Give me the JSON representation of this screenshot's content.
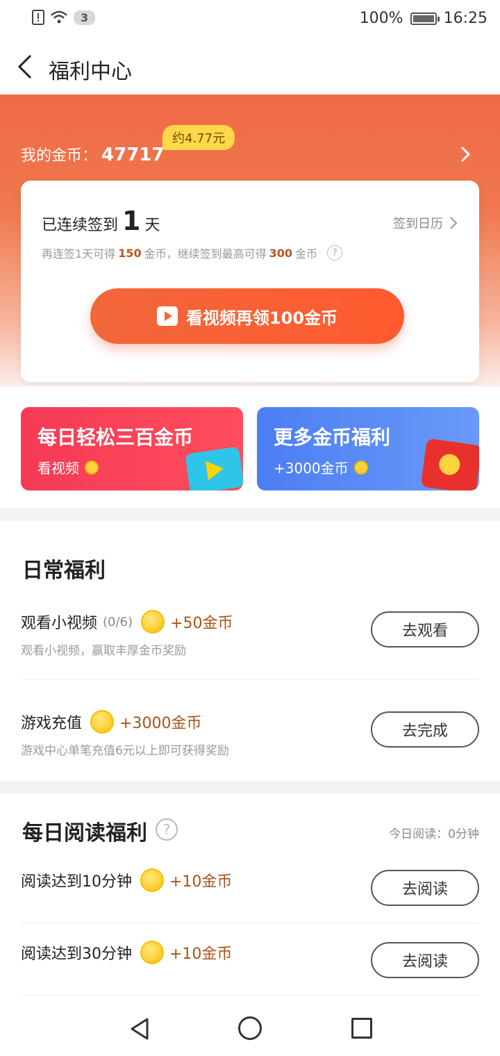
{
  "status_bar": {
    "sim_badge": "3",
    "battery_text": "100%",
    "battery_level": 1.0,
    "time": "16:25"
  },
  "header": {
    "title": "福利中心"
  },
  "coins": {
    "label": "我的金币：",
    "value": "47717",
    "approx": "约4.77元"
  },
  "sign_in": {
    "prefix": "已连续签到",
    "days": "1",
    "suffix": "天",
    "calendar_link": "签到日历",
    "desc_part1": "再连签1天可得",
    "desc_hl1": "150",
    "desc_part2": "金币，继续签到最高可得",
    "desc_hl2": "300",
    "desc_part3": "金币",
    "button": "看视频再领100金币"
  },
  "promos": [
    {
      "title": "每日轻松三百金币",
      "subtitle": "看视频"
    },
    {
      "title": "更多金币福利",
      "subtitle": "+3000金币"
    }
  ],
  "daily": {
    "title": "日常福利",
    "tasks": [
      {
        "name": "观看小视频",
        "progress": "(0/6)",
        "reward": "+50金币",
        "desc": "观看小视频，赢取丰厚金币奖励",
        "button": "去观看"
      },
      {
        "name": "游戏充值",
        "progress": "",
        "reward": "+3000金币",
        "desc": "游戏中心单笔充值6元以上即可获得奖励",
        "button": "去完成"
      }
    ]
  },
  "reading": {
    "title": "每日阅读福利",
    "help": "?",
    "today": "今日阅读：0分钟",
    "tasks": [
      {
        "name": "阅读达到10分钟",
        "reward": "+10金币",
        "button": "去阅读"
      },
      {
        "name": "阅读达到30分钟",
        "reward": "+10金币",
        "button": "去阅读"
      }
    ]
  }
}
